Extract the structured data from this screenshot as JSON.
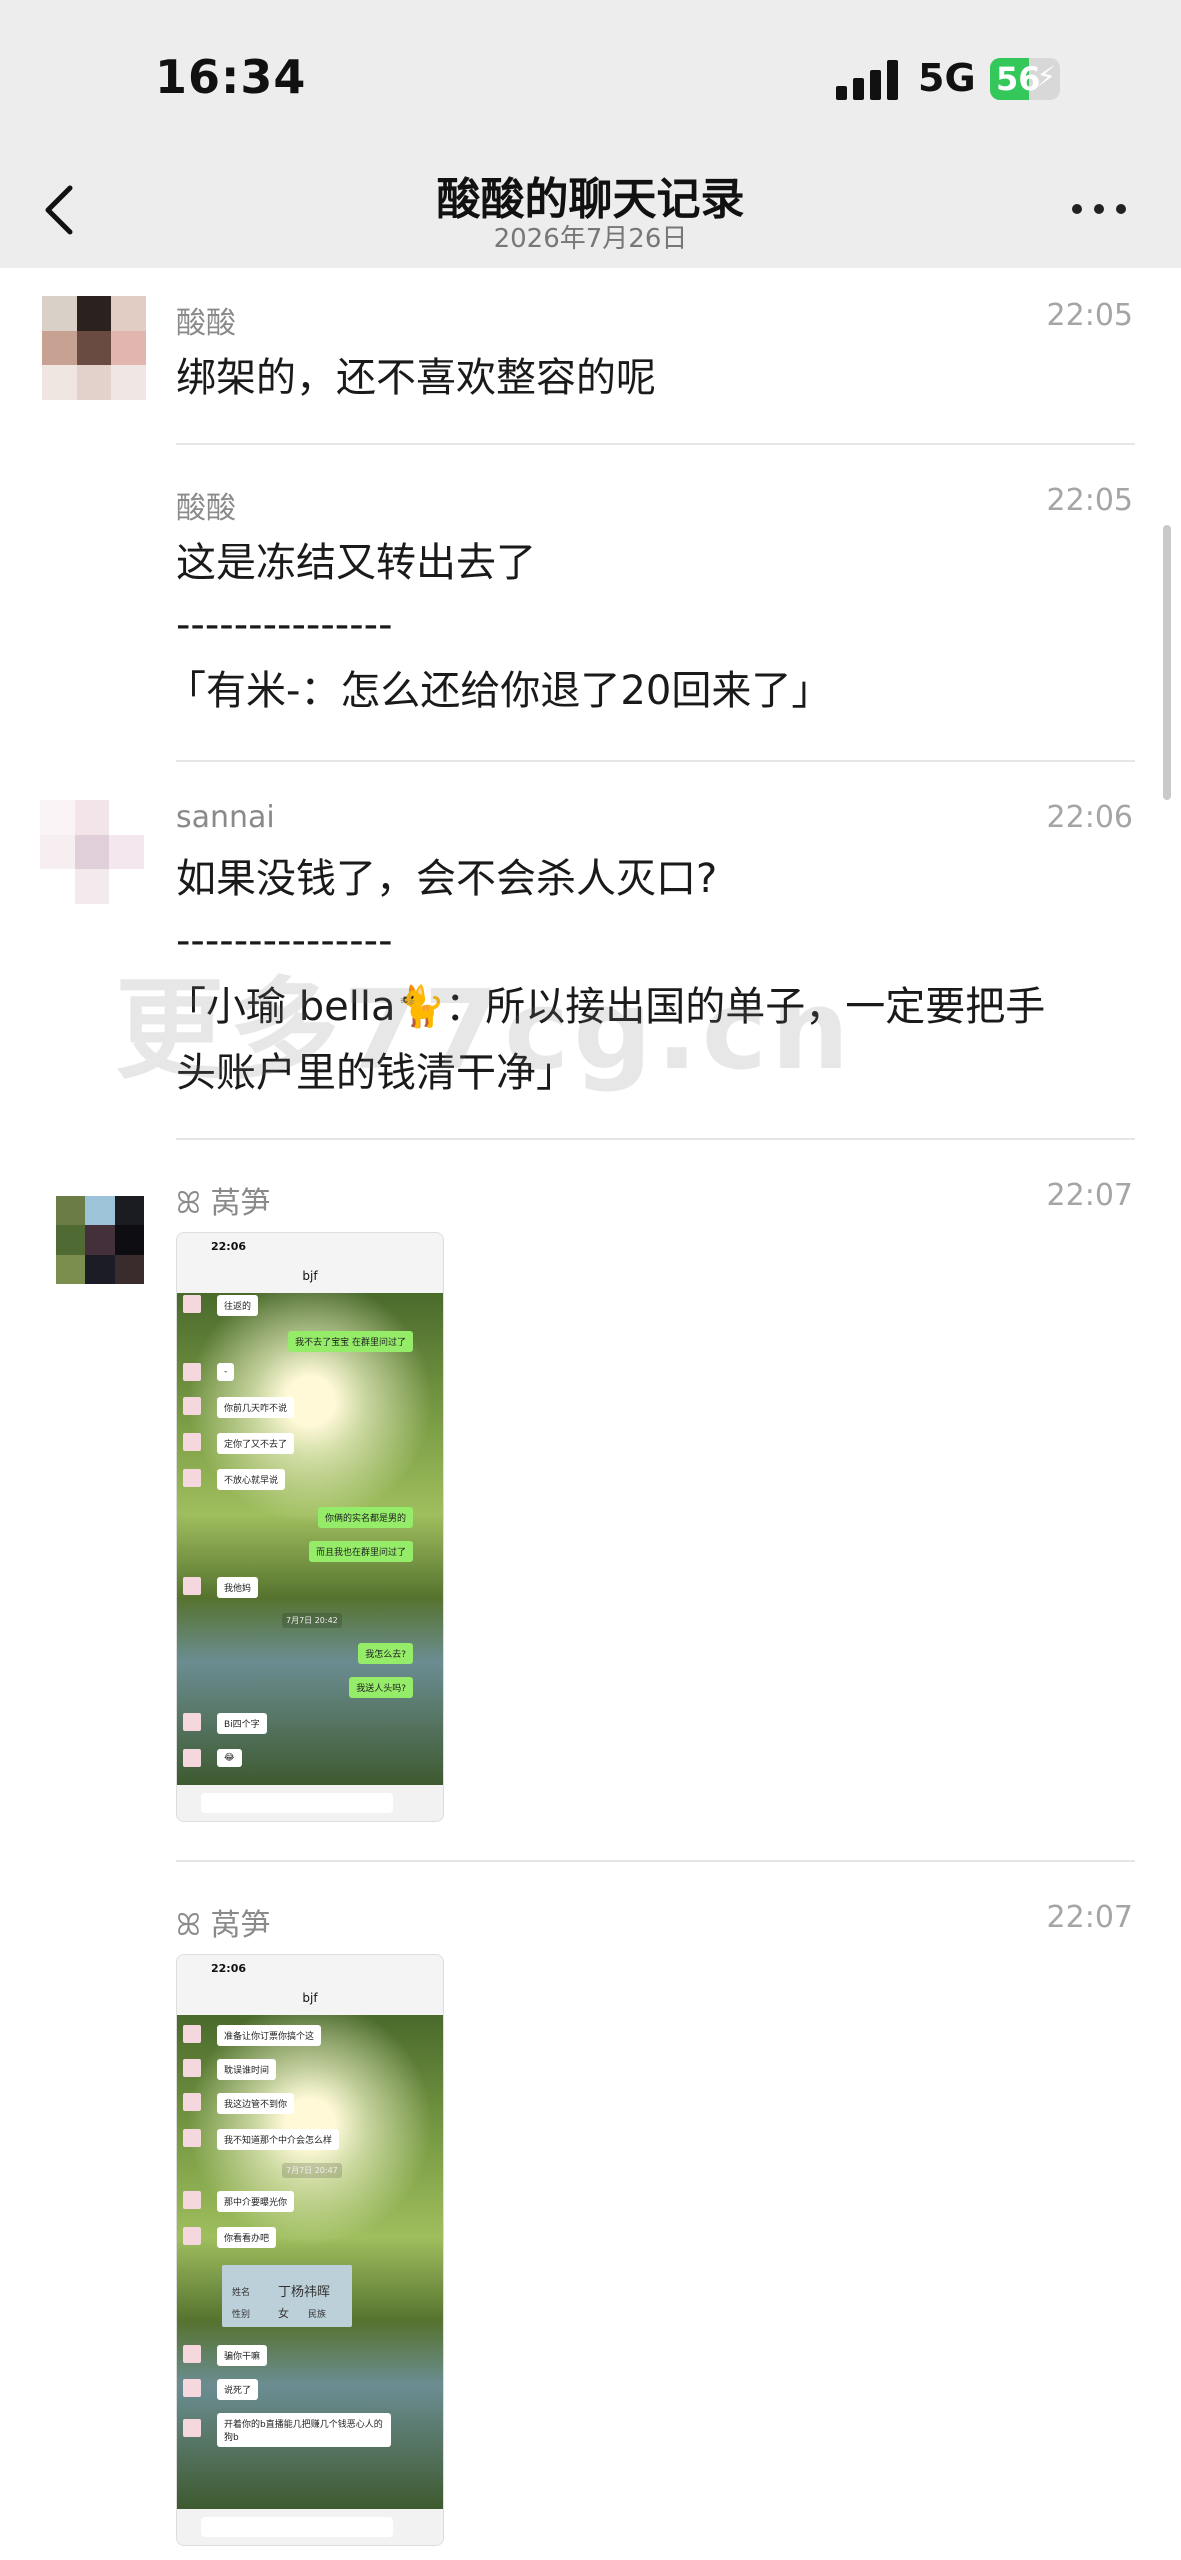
{
  "status": {
    "time": "16:34",
    "network": "5G",
    "battery": "56",
    "battery_fraction": 0.56
  },
  "header": {
    "title": "酸酸的聊天记录",
    "date": "2026年7月26日"
  },
  "messages": [
    {
      "sender": "酸酸",
      "time": "22:05",
      "lines": [
        "绑架的，还不喜欢整容的呢"
      ]
    },
    {
      "sender": "酸酸",
      "time": "22:05",
      "lines": [
        "这是冻结又转出去了",
        "---------------",
        "「有米-：怎么还给你退了20回来了」"
      ]
    },
    {
      "sender": "sannai",
      "time": "22:06",
      "lines": [
        "如果没钱了，会不会杀人灭口?",
        "---------------",
        "「小瑜 bella🐈：所以接出国的单子，一定要把手",
        "头账户里的钱清干净」"
      ]
    },
    {
      "sender": "ꕤ 莴笋",
      "time": "22:07"
    },
    {
      "sender": "ꕤ 莴笋",
      "time": "22:07"
    }
  ],
  "watermark": "更多77cg.cn",
  "screenshot1": {
    "time": "22:06",
    "title": "bjf",
    "bubbles": [
      "往返的",
      "我不去了宝宝 在群里问过了",
      "-",
      "你前几天咋不说",
      "定你了又不去了",
      "不放心就早说",
      "你俩的实名都是男的",
      "而且我也在群里问过了",
      "我他妈",
      "7月7日 20:42",
      "我怎么去?",
      "我送人头吗?",
      "Bi四个字",
      "😂"
    ]
  },
  "screenshot2": {
    "time": "22:06",
    "title": "bjf",
    "bubbles": [
      "准备让你订票你搞个这",
      "耽误谁时间",
      "我这边管不到你",
      "我不知道那个中介会怎么样",
      "7月7日 20:47",
      "那中介要曝光你",
      "你看看办吧",
      "骗你干嘛",
      "说死了",
      "开着你的b直播能几把赚几个钱恶心人的狗b"
    ],
    "card_name": "丁杨祎晖",
    "card_labels": [
      "姓名",
      "性别",
      "女",
      "民族"
    ]
  }
}
